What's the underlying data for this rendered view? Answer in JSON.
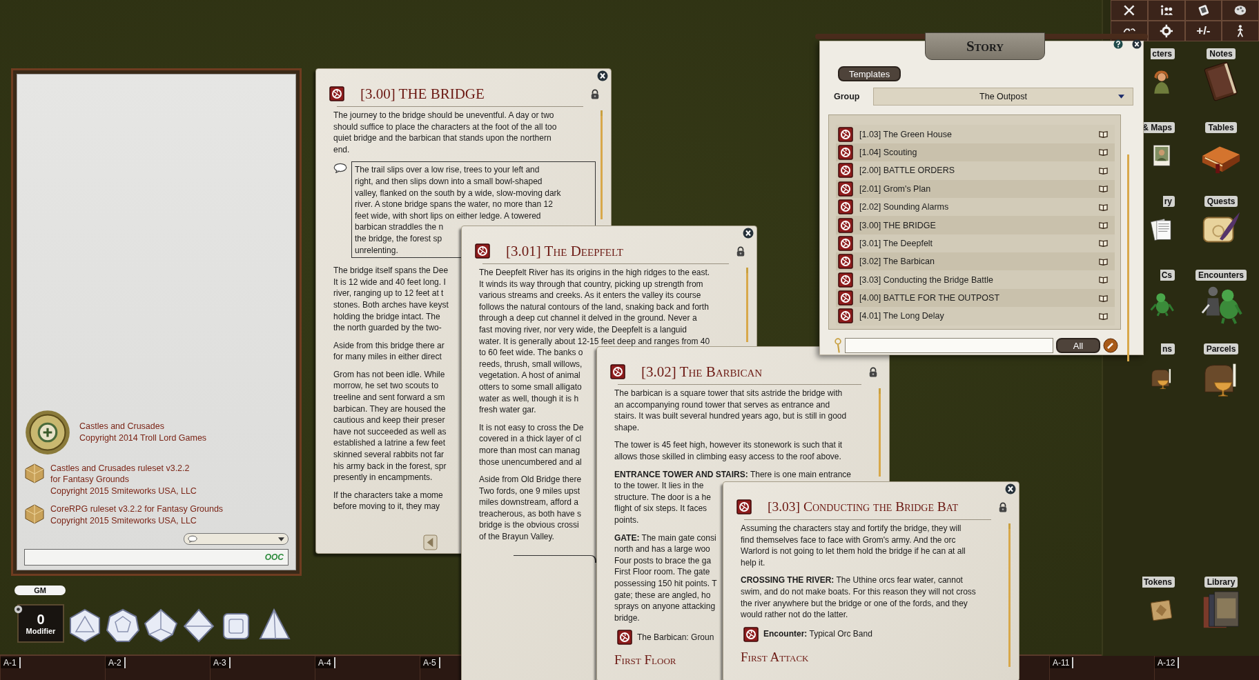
{
  "toolbar": {
    "label": "+/-"
  },
  "chat": {
    "credits": [
      {
        "kind": "logo",
        "lines": [
          "Castles and Crusades",
          "Copyright 2014 Troll Lord Games"
        ]
      },
      {
        "kind": "gem",
        "lines": [
          "Castles and Crusades ruleset v3.2.2",
          "for Fantasy Grounds",
          "Copyright 2015 Smiteworks USA, LLC"
        ]
      },
      {
        "kind": "gem",
        "lines": [
          "CoreRPG ruleset v3.2.2 for Fantasy Grounds",
          "Copyright 2015 Smiteworks USA, LLC"
        ]
      }
    ],
    "ooc_button": "OOC"
  },
  "gm_badge": "GM",
  "modifier": {
    "value": "0",
    "label": "Modifier"
  },
  "hotbar": {
    "left": [
      "A-1",
      "A-2",
      "A-3",
      "A-4",
      "A-5"
    ],
    "right": [
      "A-11",
      "A-12"
    ]
  },
  "story_entries": [
    {
      "title": "[3.00] THE BRIDGE",
      "closable": true,
      "back_button": true,
      "blocks": [
        {
          "kind": "text",
          "lines": [
            "The journey to the bridge should be uneventful. A day or two",
            "should suffice to place the characters at the foot of the all too",
            "quiet bridge and the barbican that stands upon the northern",
            "end."
          ]
        },
        {
          "kind": "boxed",
          "lines": [
            "The trail slips over a low rise, trees to your left and",
            "right, and then slips down into a small bowl-shaped",
            "valley, flanked on the south by a wide, slow-moving dark",
            "river. A stone bridge spans the water, no more than 12",
            "feet wide, with short lips on either ledge. A towered",
            "barbican straddles the n",
            "the bridge, the forest sp",
            "unrelenting."
          ]
        },
        {
          "kind": "text",
          "lines": [
            "The bridge itself spans the Dee",
            "It is 12 wide and 40 feet long. I",
            "river, ranging up to 12 feet at t",
            "stones. Both arches have keyst",
            "holding the bridge intact. The",
            "the north guarded by the two-"
          ]
        },
        {
          "kind": "text",
          "lines": [
            "Aside from this bridge there ar",
            "for many miles in either direct"
          ]
        },
        {
          "kind": "text",
          "lines": [
            "Grom has not been idle. While",
            "morrow, he set two scouts to",
            "treeline and sent forward a sm",
            "barbican. They are housed the",
            "cautious and keep their preser",
            "have not succeeded as well as",
            "established a latrine a few feet",
            "skinned several rabbits not far",
            "his army back in the forest, spr",
            "presently in encampments."
          ]
        },
        {
          "kind": "text",
          "lines": [
            "If the characters take a mome",
            "before moving to it, they may"
          ]
        }
      ]
    },
    {
      "title": "[3.01] The Deepfelt",
      "closable": true,
      "blocks": [
        {
          "kind": "text",
          "lines": [
            "The Deepfelt River has its origins in the high ridges to the east.",
            "It winds its way through that country, picking up strength from",
            "various streams and creeks. As it enters the valley its course",
            "follows the natural contours of the land, snaking back and forth",
            "through a deep cut channel it delved in the ground. Never a",
            "fast moving river, nor very wide, the Deepfelt is a languid",
            "water. It is generally about 12-15 feet deep and ranges from 40",
            "to 60 feet wide. The banks o",
            "reeds, thrush, small willows,",
            "vegetation. A host of animal",
            "otters to some small alligato",
            "water as well, though it is h",
            "fresh water gar."
          ]
        },
        {
          "kind": "text",
          "lines": [
            "It is not easy to cross the De",
            "covered in a thick layer of cl",
            "more than most can manag",
            "those unencumbered and al"
          ]
        },
        {
          "kind": "text",
          "lines": [
            "Aside from Old Bridge there",
            "Two fords, one 9 miles upst",
            "miles downstream, afford a",
            "treacherous, as both have s",
            "bridge is the obvious crossi",
            "of the Brayun Valley."
          ]
        },
        {
          "kind": "divider"
        }
      ]
    },
    {
      "title": "[3.02] The Barbican",
      "blocks": [
        {
          "kind": "text",
          "lines": [
            "The barbican is a square tower that sits astride the bridge with",
            "an accompanying round tower that serves as entrance and",
            "stairs. It was built several hundred years ago, but is still in good",
            "shape."
          ]
        },
        {
          "kind": "text",
          "lines": [
            "The tower is 45 feet high, however its stonework is such that it",
            "allows those skilled in climbing easy access to the roof above."
          ]
        },
        {
          "kind": "text",
          "lines": [
            "**ENTRANCE TOWER AND STAIRS:** There is one main entrance",
            "to the tower. It lies in the",
            "structure. The door is a he",
            "flight of six steps. It faces",
            "points."
          ]
        },
        {
          "kind": "text",
          "lines": [
            "**GATE:** The main gate consi",
            "north and has a large woo",
            "Four posts to brace the ga",
            "First Floor room. The gate",
            "possessing 150 hit points. T",
            "gate; these are angled, ho",
            "sprays on anyone attacking",
            "bridge."
          ]
        },
        {
          "kind": "link",
          "text": "The Barbican: Groun"
        },
        {
          "kind": "heading",
          "text": "First Floor"
        }
      ]
    },
    {
      "title": "[3.03] Conducting the Bridge Bat",
      "closable": true,
      "blocks": [
        {
          "kind": "text",
          "lines": [
            "Assuming the characters stay and fortify the bridge, they will",
            "find themselves face to face with Grom's army. And the orc",
            "Warlord is not going to let them hold the bridge if he can at all",
            "help it."
          ]
        },
        {
          "kind": "text",
          "lines": [
            "**CROSSING THE RIVER:** The Uthine orcs fear water, cannot",
            "swim, and do not make boats. For this reason they will not cross",
            "the river anywhere but the bridge or one of the fords, and they",
            "would rather not do the latter."
          ]
        },
        {
          "kind": "link",
          "text": "**Encounter:** Typical Orc Band"
        },
        {
          "kind": "heading",
          "text": "First Attack"
        }
      ]
    }
  ],
  "story_list": {
    "title": "Story",
    "templates_button": "Templates",
    "group_label": "Group",
    "group_value": "The Outpost",
    "items": [
      "[1.03] The Green House",
      "[1.04] Scouting",
      "[2.00] BATTLE ORDERS",
      "[2.01] Grom's Plan",
      "[2.02] Sounding Alarms",
      "[3.00] THE BRIDGE",
      "[3.01] The Deepfelt",
      "[3.02] The Barbican",
      "[3.03] Conducting the Bridge Battle",
      "[4.00] BATTLE FOR THE OUTPOST",
      "[4.01] The Long Delay"
    ],
    "filter_button": "All"
  },
  "sidebar": {
    "items": [
      {
        "label": "cters",
        "kind": "characters"
      },
      {
        "label": "Notes",
        "kind": "notes"
      },
      {
        "label": "& Maps",
        "kind": "maps"
      },
      {
        "label": "Tables",
        "kind": "tables"
      },
      {
        "label": "ry",
        "kind": "story"
      },
      {
        "label": "Quests",
        "kind": "quests"
      },
      {
        "label": "Cs",
        "kind": "npcs"
      },
      {
        "label": "Encounters",
        "kind": "encounters"
      },
      {
        "label": "ns",
        "kind": "items"
      },
      {
        "label": "Parcels",
        "kind": "parcels"
      }
    ],
    "bottom_items": [
      {
        "label": "Tokens",
        "kind": "tokens"
      },
      {
        "label": "Library",
        "kind": "library"
      }
    ]
  }
}
